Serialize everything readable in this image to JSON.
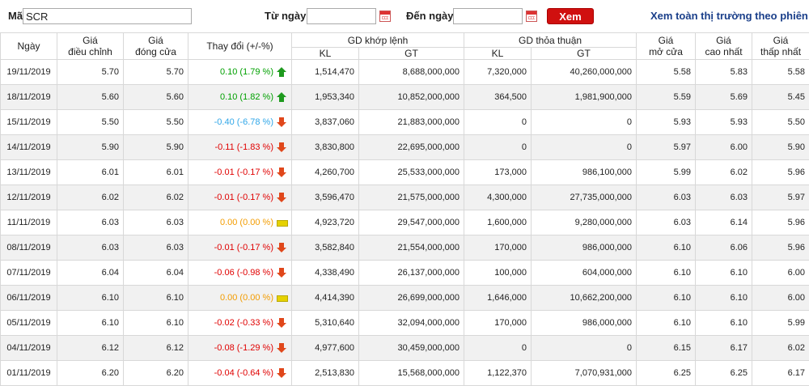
{
  "toolbar": {
    "ma_label": "Mã",
    "ma_value": "SCR",
    "from_label": "Từ ngày",
    "from_value": "",
    "to_label": "Đến ngày",
    "to_value": "",
    "xem_label": "Xem",
    "all_market_link": "Xem toàn thị trường theo phiên"
  },
  "colors": {
    "up": "#00a000",
    "down": "#e00000",
    "flat": "#f39c00",
    "floor": "#2fa6e8",
    "button": "#d0100f",
    "link": "#1a3f8a"
  },
  "headers": {
    "ngay": "Ngày",
    "gia_dieu_chinh_1": "Giá",
    "gia_dieu_chinh_2": "điều chỉnh",
    "gia_dong_cua_1": "Giá",
    "gia_dong_cua_2": "đóng cửa",
    "thay_doi": "Thay đổi (+/-%)",
    "gd_khop_lenh": "GD khớp lệnh",
    "gd_thoa_thuan": "GD thỏa thuận",
    "kl": "KL",
    "gt": "GT",
    "gia_mo_cua_1": "Giá",
    "gia_mo_cua_2": "mở cửa",
    "gia_cao_nhat_1": "Giá",
    "gia_cao_nhat_2": "cao nhất",
    "gia_thap_nhat_1": "Giá",
    "gia_thap_nhat_2": "thấp nhất"
  },
  "rows": [
    {
      "date": "19/11/2019",
      "adj": "5.70",
      "close": "5.70",
      "change": "0.10 (1.79 %)",
      "dir": "up",
      "kl": "1,514,470",
      "gt": "8,688,000,000",
      "tt_kl": "7,320,000",
      "tt_gt": "40,260,000,000",
      "open": "5.58",
      "high": "5.83",
      "low": "5.58"
    },
    {
      "date": "18/11/2019",
      "adj": "5.60",
      "close": "5.60",
      "change": "0.10 (1.82 %)",
      "dir": "up",
      "kl": "1,953,340",
      "gt": "10,852,000,000",
      "tt_kl": "364,500",
      "tt_gt": "1,981,900,000",
      "open": "5.59",
      "high": "5.69",
      "low": "5.45"
    },
    {
      "date": "15/11/2019",
      "adj": "5.50",
      "close": "5.50",
      "change": "-0.40 (-6.78 %)",
      "dir": "floor",
      "kl": "3,837,060",
      "gt": "21,883,000,000",
      "tt_kl": "0",
      "tt_gt": "0",
      "open": "5.93",
      "high": "5.93",
      "low": "5.50"
    },
    {
      "date": "14/11/2019",
      "adj": "5.90",
      "close": "5.90",
      "change": "-0.11 (-1.83 %)",
      "dir": "down",
      "kl": "3,830,800",
      "gt": "22,695,000,000",
      "tt_kl": "0",
      "tt_gt": "0",
      "open": "5.97",
      "high": "6.00",
      "low": "5.90"
    },
    {
      "date": "13/11/2019",
      "adj": "6.01",
      "close": "6.01",
      "change": "-0.01 (-0.17 %)",
      "dir": "down",
      "kl": "4,260,700",
      "gt": "25,533,000,000",
      "tt_kl": "173,000",
      "tt_gt": "986,100,000",
      "open": "5.99",
      "high": "6.02",
      "low": "5.96"
    },
    {
      "date": "12/11/2019",
      "adj": "6.02",
      "close": "6.02",
      "change": "-0.01 (-0.17 %)",
      "dir": "down",
      "kl": "3,596,470",
      "gt": "21,575,000,000",
      "tt_kl": "4,300,000",
      "tt_gt": "27,735,000,000",
      "open": "6.03",
      "high": "6.03",
      "low": "5.97"
    },
    {
      "date": "11/11/2019",
      "adj": "6.03",
      "close": "6.03",
      "change": "0.00 (0.00 %)",
      "dir": "flat",
      "kl": "4,923,720",
      "gt": "29,547,000,000",
      "tt_kl": "1,600,000",
      "tt_gt": "9,280,000,000",
      "open": "6.03",
      "high": "6.14",
      "low": "5.96"
    },
    {
      "date": "08/11/2019",
      "adj": "6.03",
      "close": "6.03",
      "change": "-0.01 (-0.17 %)",
      "dir": "down",
      "kl": "3,582,840",
      "gt": "21,554,000,000",
      "tt_kl": "170,000",
      "tt_gt": "986,000,000",
      "open": "6.10",
      "high": "6.06",
      "low": "5.96"
    },
    {
      "date": "07/11/2019",
      "adj": "6.04",
      "close": "6.04",
      "change": "-0.06 (-0.98 %)",
      "dir": "down",
      "kl": "4,338,490",
      "gt": "26,137,000,000",
      "tt_kl": "100,000",
      "tt_gt": "604,000,000",
      "open": "6.10",
      "high": "6.10",
      "low": "6.00"
    },
    {
      "date": "06/11/2019",
      "adj": "6.10",
      "close": "6.10",
      "change": "0.00 (0.00 %)",
      "dir": "flat",
      "kl": "4,414,390",
      "gt": "26,699,000,000",
      "tt_kl": "1,646,000",
      "tt_gt": "10,662,200,000",
      "open": "6.10",
      "high": "6.10",
      "low": "6.00"
    },
    {
      "date": "05/11/2019",
      "adj": "6.10",
      "close": "6.10",
      "change": "-0.02 (-0.33 %)",
      "dir": "down",
      "kl": "5,310,640",
      "gt": "32,094,000,000",
      "tt_kl": "170,000",
      "tt_gt": "986,000,000",
      "open": "6.10",
      "high": "6.10",
      "low": "5.99"
    },
    {
      "date": "04/11/2019",
      "adj": "6.12",
      "close": "6.12",
      "change": "-0.08 (-1.29 %)",
      "dir": "down",
      "kl": "4,977,600",
      "gt": "30,459,000,000",
      "tt_kl": "0",
      "tt_gt": "0",
      "open": "6.15",
      "high": "6.17",
      "low": "6.02"
    },
    {
      "date": "01/11/2019",
      "adj": "6.20",
      "close": "6.20",
      "change": "-0.04 (-0.64 %)",
      "dir": "down",
      "kl": "2,513,830",
      "gt": "15,568,000,000",
      "tt_kl": "1,122,370",
      "tt_gt": "7,070,931,000",
      "open": "6.25",
      "high": "6.25",
      "low": "6.17"
    }
  ]
}
